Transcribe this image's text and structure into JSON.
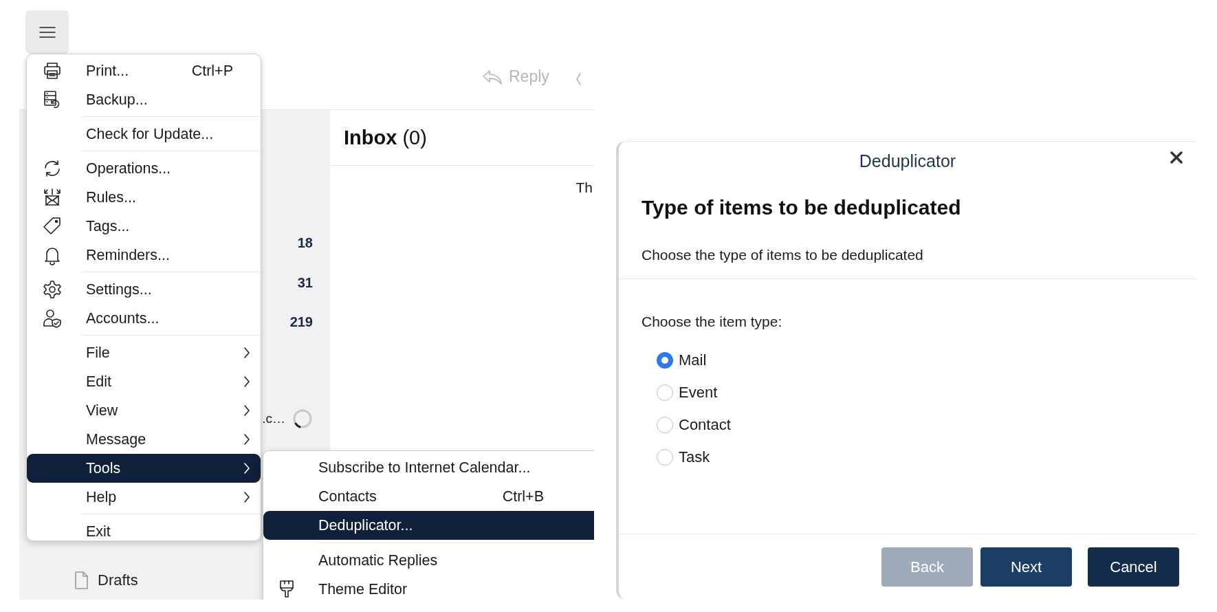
{
  "toolbar": {
    "reply": {
      "label": "Reply",
      "disabled": true
    }
  },
  "sidebar": {
    "rows": [
      {
        "count": "18"
      },
      {
        "count": "31"
      },
      {
        "count": "219"
      }
    ],
    "loading_item": {
      "label": ".c…"
    },
    "folders": [
      {
        "label": "Drafts"
      }
    ]
  },
  "message_list": {
    "title": "Inbox",
    "count": "(0)",
    "column_1": "Th"
  },
  "main_menu": {
    "groups": [
      [
        {
          "label": "Print...",
          "shortcut": "Ctrl+P",
          "submenu": false,
          "selected": false
        },
        {
          "label": "Backup...",
          "submenu": false,
          "selected": false
        }
      ],
      [
        {
          "label": "Check for Update...",
          "submenu": false,
          "selected": false
        }
      ],
      [
        {
          "label": "Operations...",
          "submenu": false,
          "selected": false
        },
        {
          "label": "Rules...",
          "submenu": false,
          "selected": false
        },
        {
          "label": "Tags...",
          "submenu": false,
          "selected": false
        },
        {
          "label": "Reminders...",
          "submenu": false,
          "selected": false
        }
      ],
      [
        {
          "label": "Settings...",
          "submenu": false,
          "selected": false
        },
        {
          "label": "Accounts...",
          "submenu": false,
          "selected": false
        }
      ],
      [
        {
          "label": "File",
          "submenu": true,
          "selected": false
        },
        {
          "label": "Edit",
          "submenu": true,
          "selected": false
        },
        {
          "label": "View",
          "submenu": true,
          "selected": false
        },
        {
          "label": "Message",
          "submenu": true,
          "selected": false
        },
        {
          "label": "Tools",
          "submenu": true,
          "selected": true
        },
        {
          "label": "Help",
          "submenu": true,
          "selected": false
        }
      ],
      [
        {
          "label": "Exit",
          "submenu": false,
          "selected": false
        }
      ]
    ]
  },
  "tools_submenu": {
    "groups": [
      [
        {
          "label": "Subscribe to Internet Calendar...",
          "selected": false
        },
        {
          "label": "Contacts",
          "shortcut": "Ctrl+B",
          "selected": false
        },
        {
          "label": "Deduplicator...",
          "selected": true
        }
      ],
      [
        {
          "label": "Automatic Replies",
          "selected": false
        },
        {
          "label": "Theme Editor",
          "selected": false
        }
      ]
    ]
  },
  "dialog": {
    "title": "Deduplicator",
    "heading": "Type of items to be deduplicated",
    "description": "Choose the type of items to be deduplicated",
    "prompt": "Choose the item type:",
    "options": [
      {
        "label": "Mail",
        "selected": true
      },
      {
        "label": "Event",
        "selected": false
      },
      {
        "label": "Contact",
        "selected": false
      },
      {
        "label": "Task",
        "selected": false
      }
    ],
    "buttons": [
      {
        "label": "Back",
        "kind": "secondary",
        "disabled": true
      },
      {
        "label": "Next",
        "kind": "primary",
        "disabled": false
      },
      {
        "label": "Cancel",
        "kind": "cancel",
        "disabled": false
      }
    ]
  }
}
